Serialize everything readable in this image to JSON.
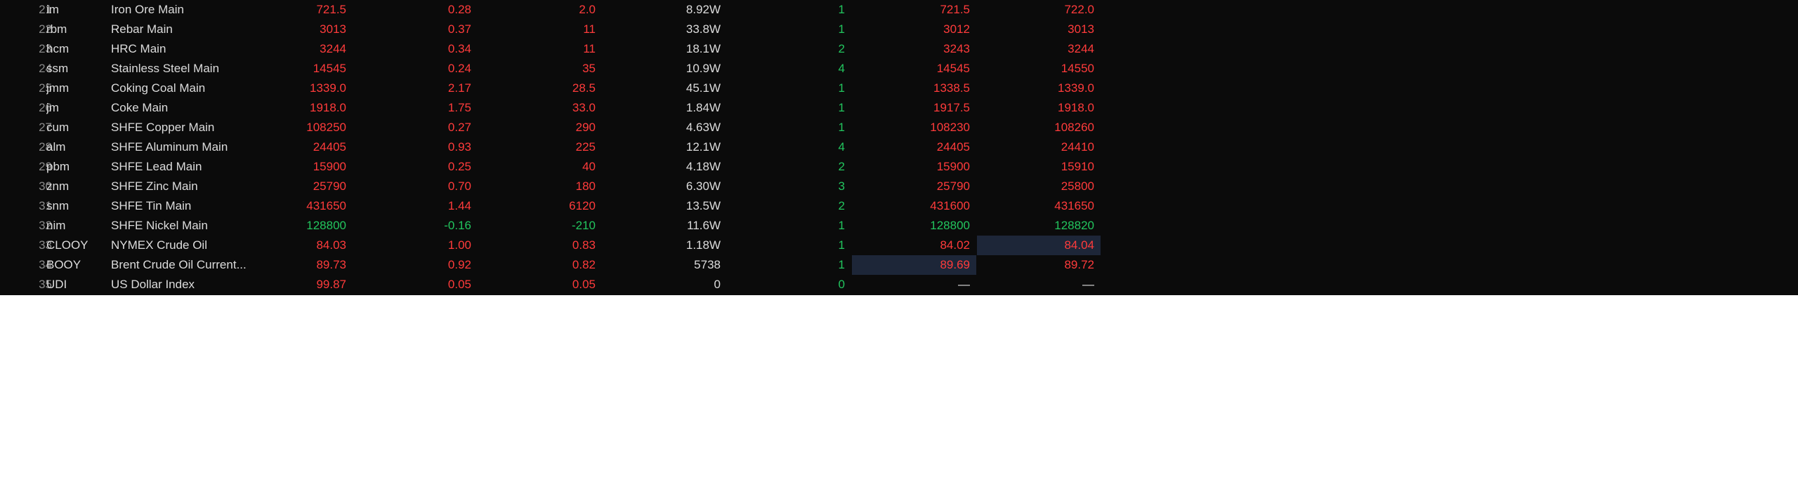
{
  "colors": {
    "background": "#0b0b0b",
    "up": "#ff3b3b",
    "down": "#22c55e",
    "neutral": "#dcdcdc",
    "index": "#8a8a8a",
    "highlight": "#1d2638"
  },
  "rows": [
    {
      "idx": "21",
      "code": "im",
      "name": "Iron Ore Main",
      "last": "721.5",
      "pct": "0.28",
      "chg": "2.0",
      "vol": "8.92W",
      "cur": "1",
      "bid": "721.5",
      "ask": "722.0",
      "dir": "up",
      "bid_dir": "up",
      "ask_dir": "up"
    },
    {
      "idx": "22",
      "code": "rbm",
      "name": "Rebar Main",
      "last": "3013",
      "pct": "0.37",
      "chg": "11",
      "vol": "33.8W",
      "cur": "1",
      "bid": "3012",
      "ask": "3013",
      "dir": "up",
      "bid_dir": "up",
      "ask_dir": "up"
    },
    {
      "idx": "23",
      "code": "hcm",
      "name": "HRC Main",
      "last": "3244",
      "pct": "0.34",
      "chg": "11",
      "vol": "18.1W",
      "cur": "2",
      "bid": "3243",
      "ask": "3244",
      "dir": "up",
      "bid_dir": "up",
      "ask_dir": "up"
    },
    {
      "idx": "24",
      "code": "ssm",
      "name": "Stainless Steel Main",
      "last": "14545",
      "pct": "0.24",
      "chg": "35",
      "vol": "10.9W",
      "cur": "4",
      "bid": "14545",
      "ask": "14550",
      "dir": "up",
      "bid_dir": "up",
      "ask_dir": "up"
    },
    {
      "idx": "25",
      "code": "jmm",
      "name": "Coking Coal Main",
      "last": "1339.0",
      "pct": "2.17",
      "chg": "28.5",
      "vol": "45.1W",
      "cur": "1",
      "bid": "1338.5",
      "ask": "1339.0",
      "dir": "up",
      "bid_dir": "up",
      "ask_dir": "up"
    },
    {
      "idx": "26",
      "code": "jm",
      "name": "Coke Main",
      "last": "1918.0",
      "pct": "1.75",
      "chg": "33.0",
      "vol": "1.84W",
      "cur": "1",
      "bid": "1917.5",
      "ask": "1918.0",
      "dir": "up",
      "bid_dir": "up",
      "ask_dir": "up"
    },
    {
      "idx": "27",
      "code": "cum",
      "name": "SHFE Copper Main",
      "last": "108250",
      "pct": "0.27",
      "chg": "290",
      "vol": "4.63W",
      "cur": "1",
      "bid": "108230",
      "ask": "108260",
      "dir": "up",
      "bid_dir": "up",
      "ask_dir": "up"
    },
    {
      "idx": "28",
      "code": "alm",
      "name": "SHFE Aluminum Main",
      "last": "24405",
      "pct": "0.93",
      "chg": "225",
      "vol": "12.1W",
      "cur": "4",
      "bid": "24405",
      "ask": "24410",
      "dir": "up",
      "bid_dir": "up",
      "ask_dir": "up"
    },
    {
      "idx": "29",
      "code": "pbm",
      "name": "SHFE Lead Main",
      "last": "15900",
      "pct": "0.25",
      "chg": "40",
      "vol": "4.18W",
      "cur": "2",
      "bid": "15900",
      "ask": "15910",
      "dir": "up",
      "bid_dir": "up",
      "ask_dir": "up"
    },
    {
      "idx": "30",
      "code": "znm",
      "name": "SHFE Zinc Main",
      "last": "25790",
      "pct": "0.70",
      "chg": "180",
      "vol": "6.30W",
      "cur": "3",
      "bid": "25790",
      "ask": "25800",
      "dir": "up",
      "bid_dir": "up",
      "ask_dir": "up"
    },
    {
      "idx": "31",
      "code": "snm",
      "name": "SHFE Tin Main",
      "last": "431650",
      "pct": "1.44",
      "chg": "6120",
      "vol": "13.5W",
      "cur": "2",
      "bid": "431600",
      "ask": "431650",
      "dir": "up",
      "bid_dir": "up",
      "ask_dir": "up"
    },
    {
      "idx": "32",
      "code": "nim",
      "name": "SHFE Nickel Main",
      "last": "128800",
      "pct": "-0.16",
      "chg": "-210",
      "vol": "11.6W",
      "cur": "1",
      "bid": "128800",
      "ask": "128820",
      "dir": "down",
      "bid_dir": "down",
      "ask_dir": "down"
    },
    {
      "idx": "33",
      "code": "CLOOY",
      "name": "NYMEX Crude Oil",
      "last": "84.03",
      "pct": "1.00",
      "chg": "0.83",
      "vol": "1.18W",
      "cur": "1",
      "bid": "84.02",
      "ask": "84.04",
      "dir": "up",
      "bid_dir": "up",
      "ask_dir": "up"
    },
    {
      "idx": "34",
      "code": "BOOY",
      "name": "Brent Crude Oil Current...",
      "last": "89.73",
      "pct": "0.92",
      "chg": "0.82",
      "vol": "5738",
      "cur": "1",
      "bid": "89.69",
      "ask": "89.72",
      "dir": "up",
      "bid_dir": "up",
      "ask_dir": "up"
    },
    {
      "idx": "35",
      "code": "UDI",
      "name": "US Dollar Index",
      "last": "99.87",
      "pct": "0.05",
      "chg": "0.05",
      "vol": "0",
      "cur": "0",
      "bid": "—",
      "ask": "—",
      "dir": "up",
      "bid_dir": "flat",
      "ask_dir": "flat"
    }
  ]
}
